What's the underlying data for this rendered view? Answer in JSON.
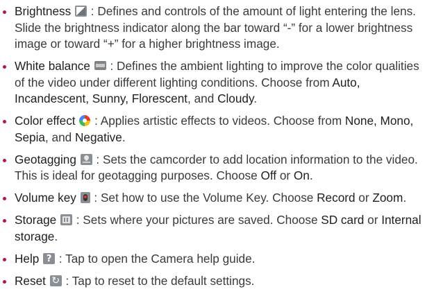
{
  "items": [
    {
      "term": "Brightness",
      "icon": "brightness-icon",
      "desc": " : Defines and controls of the amount of light entering the lens. Slide the brightness indicator along the bar toward “-” for a lower brightness image or toward “+” for a higher brightness image."
    },
    {
      "term": "White balance",
      "icon": "white-balance-icon",
      "desc": " : Defines the ambient lighting to improve the color qualities of the video under different lighting conditions. Choose from ",
      "options": [
        "Auto, Incandescent, Sunny, Florescent",
        "Cloudy"
      ],
      "connector": ", and ",
      "end": "."
    },
    {
      "term": "Color effect",
      "icon": "color-effect-icon",
      "desc": " : Applies artistic effects to videos. Choose from ",
      "options": [
        "None, Mono, Sepia",
        "Negative"
      ],
      "connector": ", and ",
      "end": "."
    },
    {
      "term": "Geotagging",
      "icon": "location-pin-icon",
      "desc": " : Sets the camcorder to add location information to the video. This is ideal for geotagging purposes. Choose ",
      "options": [
        "Off",
        "On"
      ],
      "connector": " or ",
      "end": "."
    },
    {
      "term": "Volume key",
      "icon": "volume-key-icon",
      "desc": " : Set how to use the Volume Key. Choose ",
      "options": [
        "Record",
        "Zoom"
      ],
      "connector": " or ",
      "end": "."
    },
    {
      "term": "Storage",
      "icon": "storage-icon",
      "desc": " : Sets where your pictures are saved. Choose ",
      "options": [
        "SD card",
        "Internal storage"
      ],
      "connector": " or ",
      "end": "."
    },
    {
      "term": "Help",
      "icon": "help-icon",
      "desc": " : Tap to open the Camera help guide."
    },
    {
      "term": "Reset",
      "icon": "reset-icon",
      "desc": " : Tap to reset to the default settings."
    }
  ],
  "colors": {
    "bullet": "#b5144c",
    "text": "#3a3a3a",
    "emphasis": "#1e1e1e"
  }
}
